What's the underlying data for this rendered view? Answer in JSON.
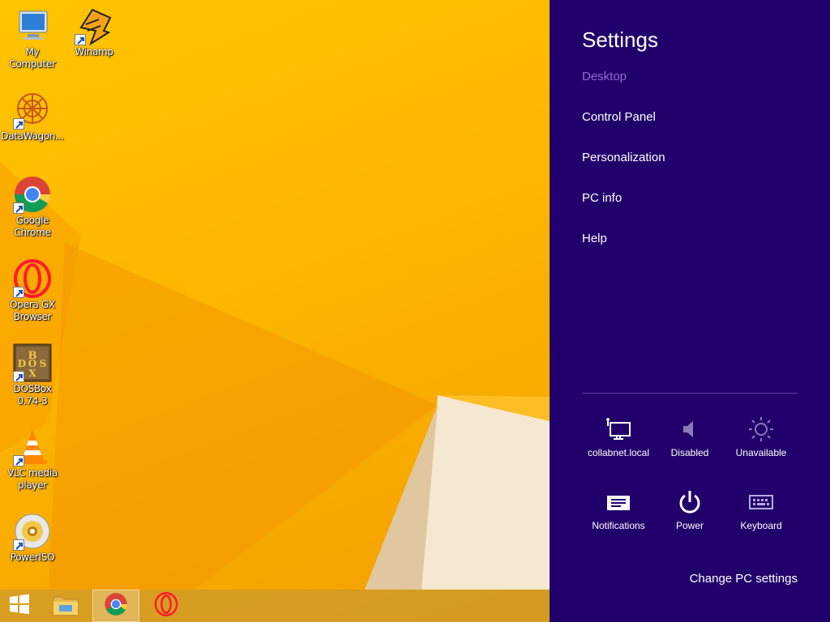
{
  "desktop": {
    "icons": [
      {
        "label": "My Computer",
        "icon": "my-computer-icon"
      },
      {
        "label": "Winamp",
        "icon": "winamp-icon"
      },
      {
        "label": "DataWagon...",
        "icon": "datawagon-icon"
      },
      {
        "label": "Google Chrome",
        "icon": "chrome-icon"
      },
      {
        "label": "Opera GX Browser",
        "icon": "opera-gx-icon"
      },
      {
        "label": "DOSBox 0.74-3",
        "icon": "dosbox-icon"
      },
      {
        "label": "VLC media player",
        "icon": "vlc-icon"
      },
      {
        "label": "PowerISO",
        "icon": "poweriso-icon"
      }
    ]
  },
  "taskbar": {
    "items": [
      {
        "icon": "start-windows-icon"
      },
      {
        "icon": "file-explorer-icon"
      },
      {
        "icon": "chrome-icon",
        "active": true
      },
      {
        "icon": "opera-gx-icon"
      }
    ]
  },
  "settings": {
    "title": "Settings",
    "context": "Desktop",
    "links": [
      "Control Panel",
      "Personalization",
      "PC info",
      "Help"
    ],
    "quick": [
      {
        "label": "collabnet.local",
        "icon": "network-icon"
      },
      {
        "label": "Disabled",
        "icon": "volume-icon"
      },
      {
        "label": "Unavailable",
        "icon": "brightness-icon"
      },
      {
        "label": "Notifications",
        "icon": "notifications-icon"
      },
      {
        "label": "Power",
        "icon": "power-icon"
      },
      {
        "label": "Keyboard",
        "icon": "keyboard-icon"
      }
    ],
    "change_pc_settings": "Change PC settings"
  },
  "colors": {
    "charm_bg": "#22006b",
    "wallpaper": "#ffb800",
    "muted_text": "#8a6fd0"
  }
}
